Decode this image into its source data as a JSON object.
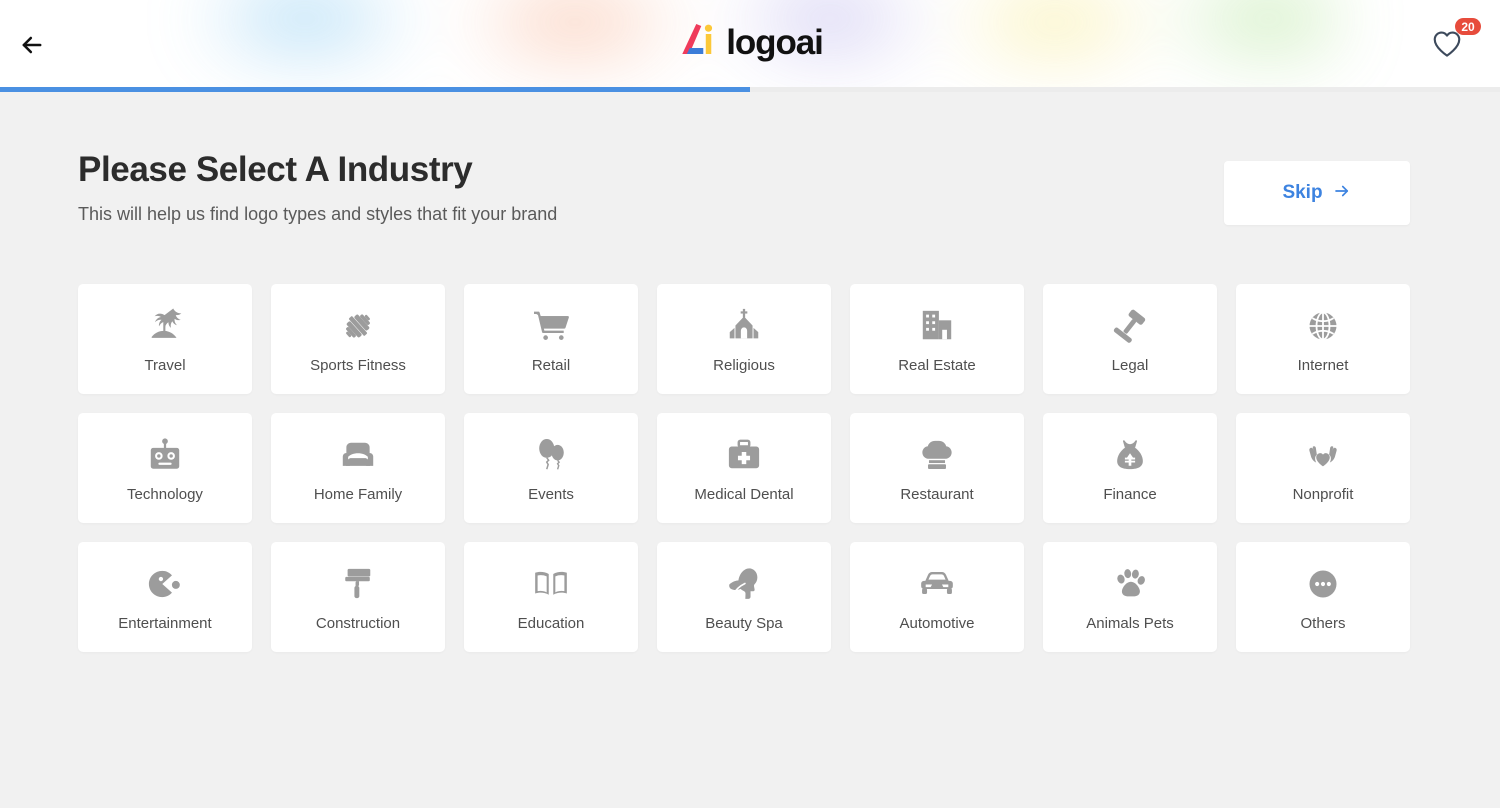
{
  "header": {
    "back_icon": "arrow-left-icon",
    "brand_name": "logoai",
    "favorites_icon": "heart-icon",
    "favorites_count": "20",
    "progress_percent": 50,
    "accent_color": "#4a90e2",
    "badge_color": "#e74c3c"
  },
  "main": {
    "title": "Please Select A Industry",
    "subtitle": "This will help us find logo types and styles that fit your brand",
    "skip": {
      "label": "Skip",
      "icon": "arrow-right-icon",
      "color": "#3d83e0"
    }
  },
  "industries": [
    {
      "label": "Travel",
      "icon": "palm-tree-icon"
    },
    {
      "label": "Sports Fitness",
      "icon": "dumbbell-icon"
    },
    {
      "label": "Retail",
      "icon": "shopping-cart-icon"
    },
    {
      "label": "Religious",
      "icon": "church-icon"
    },
    {
      "label": "Real Estate",
      "icon": "building-icon"
    },
    {
      "label": "Legal",
      "icon": "gavel-icon"
    },
    {
      "label": "Internet",
      "icon": "globe-icon"
    },
    {
      "label": "Technology",
      "icon": "robot-icon"
    },
    {
      "label": "Home Family",
      "icon": "armchair-icon"
    },
    {
      "label": "Events",
      "icon": "balloons-icon"
    },
    {
      "label": "Medical Dental",
      "icon": "first-aid-kit-icon"
    },
    {
      "label": "Restaurant",
      "icon": "chef-hat-icon"
    },
    {
      "label": "Finance",
      "icon": "money-bag-icon"
    },
    {
      "label": "Nonprofit",
      "icon": "hands-heart-icon"
    },
    {
      "label": "Entertainment",
      "icon": "pacman-icon"
    },
    {
      "label": "Construction",
      "icon": "paint-roller-icon"
    },
    {
      "label": "Education",
      "icon": "open-book-icon"
    },
    {
      "label": "Beauty Spa",
      "icon": "beauty-face-leaf-icon"
    },
    {
      "label": "Automotive",
      "icon": "car-icon"
    },
    {
      "label": "Animals Pets",
      "icon": "paw-print-icon"
    },
    {
      "label": "Others",
      "icon": "ellipsis-circle-icon"
    }
  ]
}
